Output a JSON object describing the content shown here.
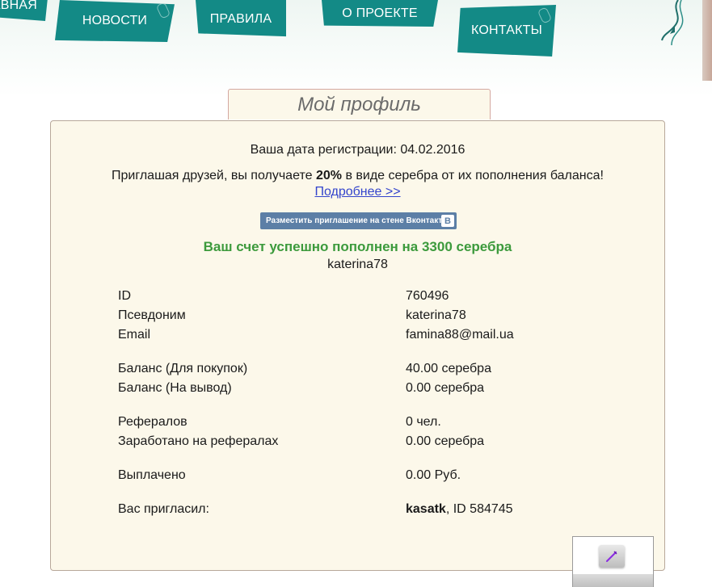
{
  "nav": {
    "home": "ГЛАВНАЯ",
    "news": "НОВОСТИ",
    "rules": "ПРАВИЛА",
    "about": "О ПРОЕКТЕ",
    "contacts": "КОНТАКТЫ"
  },
  "profile": {
    "title": "Мой профиль",
    "reg_date_label": "Ваша дата регистрации:",
    "reg_date": "04.02.2016",
    "invite_before": "Приглашая друзей, вы получаете",
    "invite_percent": "20%",
    "invite_after": "в виде серебра от их пополнения баланса!",
    "more_link": "Подробнее >>",
    "vk_button": "Разместить приглашение на стене Вконтакте",
    "vk_logo": "B",
    "success": "Ваш счет успешно пополнен на 3300 серебра",
    "username": "katerina78"
  },
  "details": {
    "id_label": "ID",
    "id": "760496",
    "nick_label": "Псевдоним",
    "nick": "katerina78",
    "email_label": "Email",
    "email": "famina88@mail.ua",
    "balance_buy_label": "Баланс (Для покупок)",
    "balance_buy": "40.00 серебра",
    "balance_out_label": "Баланс (На вывод)",
    "balance_out": "0.00 серебра",
    "referrals_label": "Рефералов",
    "referrals": "0 чел.",
    "earned_label": "Заработано на рефералах",
    "earned": "0.00 серебра",
    "paid_label": "Выплачено",
    "paid": "0.00 Руб.",
    "inviter_label": "Вас пригласил:",
    "inviter_name": "kasatk",
    "inviter_id": ", ID 584745"
  },
  "colors": {
    "nav": "#138a86",
    "panel_bg": "#fcf8ea",
    "success": "#3c9a3c",
    "link": "#3344cc",
    "vk": "#5c7fa6"
  }
}
